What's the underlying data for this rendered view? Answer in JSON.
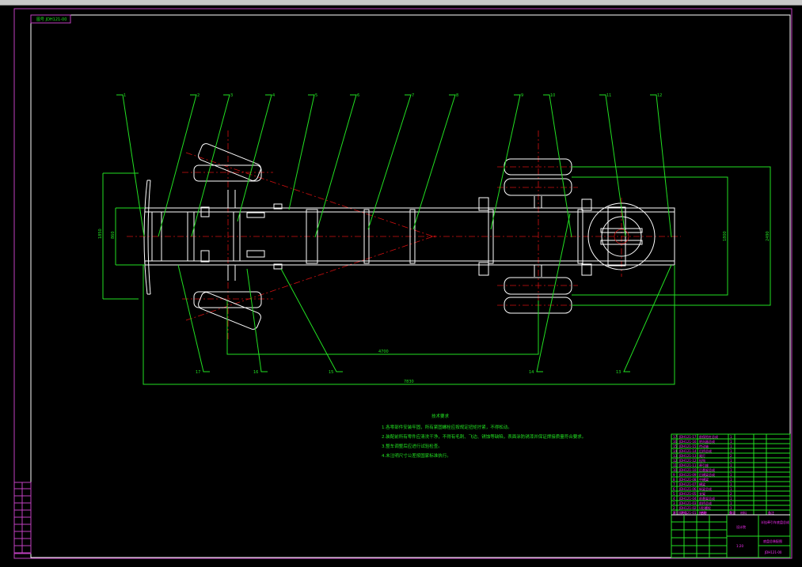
{
  "drawing_label": "图号 JDH121-00",
  "balloons_top": [
    "1",
    "2",
    "3",
    "4",
    "5",
    "6",
    "7",
    "8",
    "9",
    "10",
    "11",
    "12"
  ],
  "balloons_bottom": [
    "17",
    "16",
    "15",
    "14",
    "13"
  ],
  "dimensions": {
    "left_outer": "1850",
    "left_inner": "860",
    "wheelbase": "4700",
    "overall": "7830",
    "right_inner": "1800",
    "right_outer": "2490"
  },
  "notes": {
    "title": "技术要求",
    "lines": [
      "1.各零部件安装牢固，所有紧固螺栓应按规定扭矩拧紧，不得松动。",
      "2.装配前所有零件应清洗干净，不得有毛刺、飞边、锈蚀等缺陷，表面涂防锈漆并保证焊接质量符合要求。",
      "3.整车调整后应进行试验检查。",
      "4.未注明尺寸公差按国家标准执行。"
    ]
  },
  "parts": [
    {
      "no": "17",
      "code": "JDH121-17",
      "name": "前保险杠总成",
      "qty": "1"
    },
    {
      "no": "16",
      "code": "JDH121-16",
      "name": "转向器总成",
      "qty": "1"
    },
    {
      "no": "15",
      "code": "JDH121-15",
      "name": "传动轴",
      "qty": "1"
    },
    {
      "no": "14",
      "code": "JDH121-14",
      "name": "后桥总成",
      "qty": "1"
    },
    {
      "no": "13",
      "code": "JDH121-13",
      "name": "尾灯",
      "qty": "2"
    },
    {
      "no": "12",
      "code": "JDH121-12",
      "name": "挂钩",
      "qty": "1"
    },
    {
      "no": "11",
      "code": "JDH121-11",
      "name": "牵引座",
      "qty": "1"
    },
    {
      "no": "10",
      "code": "JDH121-10",
      "name": "后悬架总成",
      "qty": "1"
    },
    {
      "no": "9",
      "code": "JDH121-09",
      "name": "后横梁总成",
      "qty": "1"
    },
    {
      "no": "8",
      "code": "JDH121-08",
      "name": "中横梁",
      "qty": "1"
    },
    {
      "no": "7",
      "code": "JDH121-07",
      "name": "横梁",
      "qty": "1"
    },
    {
      "no": "6",
      "code": "JDH121-06",
      "name": "纵梁总成",
      "qty": "1"
    },
    {
      "no": "5",
      "code": "JDH121-05",
      "name": "支架",
      "qty": "2"
    },
    {
      "no": "4",
      "code": "JDH121-04",
      "name": "前悬架总成",
      "qty": "1"
    },
    {
      "no": "3",
      "code": "JDH121-03",
      "name": "前桥总成",
      "qty": "1"
    },
    {
      "no": "2",
      "code": "JDH121-02",
      "name": "U形螺栓",
      "qty": "1"
    },
    {
      "no": "1",
      "code": "JDH121-01",
      "name": "拖钩",
      "qty": "1"
    }
  ],
  "title_block": {
    "org": "设计院",
    "title": "半挂牵引车底盘总成",
    "subtitle": "底盘总装配图",
    "drawing_no": "JDH121-00",
    "scale": "1:20",
    "headers": [
      "序号",
      "代号",
      "名称",
      "数量",
      "材料",
      "备注"
    ]
  },
  "colors": {
    "frame": "#ffffff",
    "leader": "#22e022",
    "centerline": "#d01010",
    "border": "#c040c0",
    "text": "#ff30ff"
  }
}
